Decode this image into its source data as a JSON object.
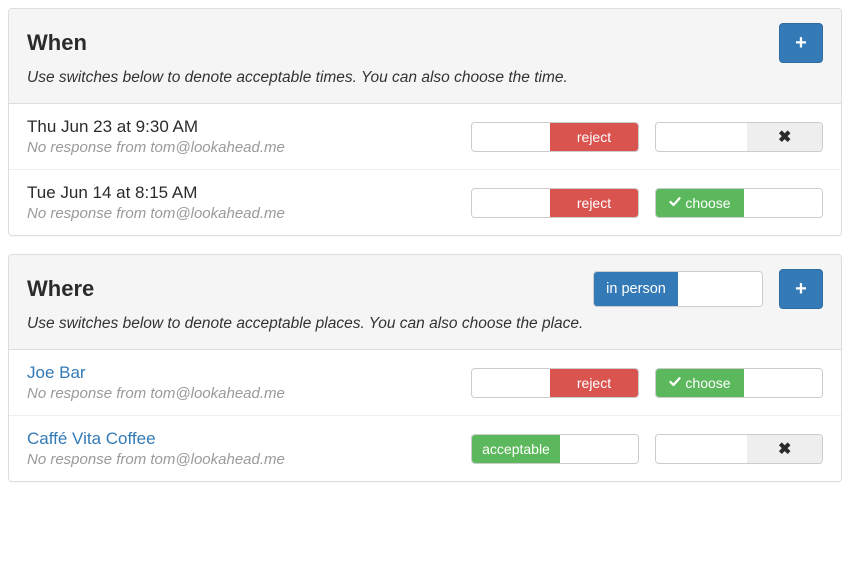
{
  "when": {
    "title": "When",
    "subtitle": "Use switches below to denote acceptable times.  You can also choose the time.",
    "items": [
      {
        "title": "Thu Jun 23 at 9:30 AM",
        "subtitle": "No response from tom@lookahead.me",
        "left_label": "reject",
        "right_type": "x",
        "right_label": "✖"
      },
      {
        "title": "Tue Jun 14 at 8:15 AM",
        "subtitle": "No response from tom@lookahead.me",
        "left_label": "reject",
        "right_type": "choose",
        "right_label": "choose"
      }
    ]
  },
  "where": {
    "title": "Where",
    "subtitle": "Use switches below to denote acceptable places.  You can also choose the place.",
    "inperson_label": "in person",
    "items": [
      {
        "title": "Joe Bar",
        "subtitle": "No response from tom@lookahead.me",
        "left_type": "reject",
        "left_label": "reject",
        "right_type": "choose",
        "right_label": "choose"
      },
      {
        "title": "Caffé Vita Coffee",
        "subtitle": "No response from tom@lookahead.me",
        "left_type": "acceptable",
        "left_label": "acceptable",
        "right_type": "x",
        "right_label": "✖"
      }
    ]
  },
  "icons": {
    "plus": "+"
  }
}
